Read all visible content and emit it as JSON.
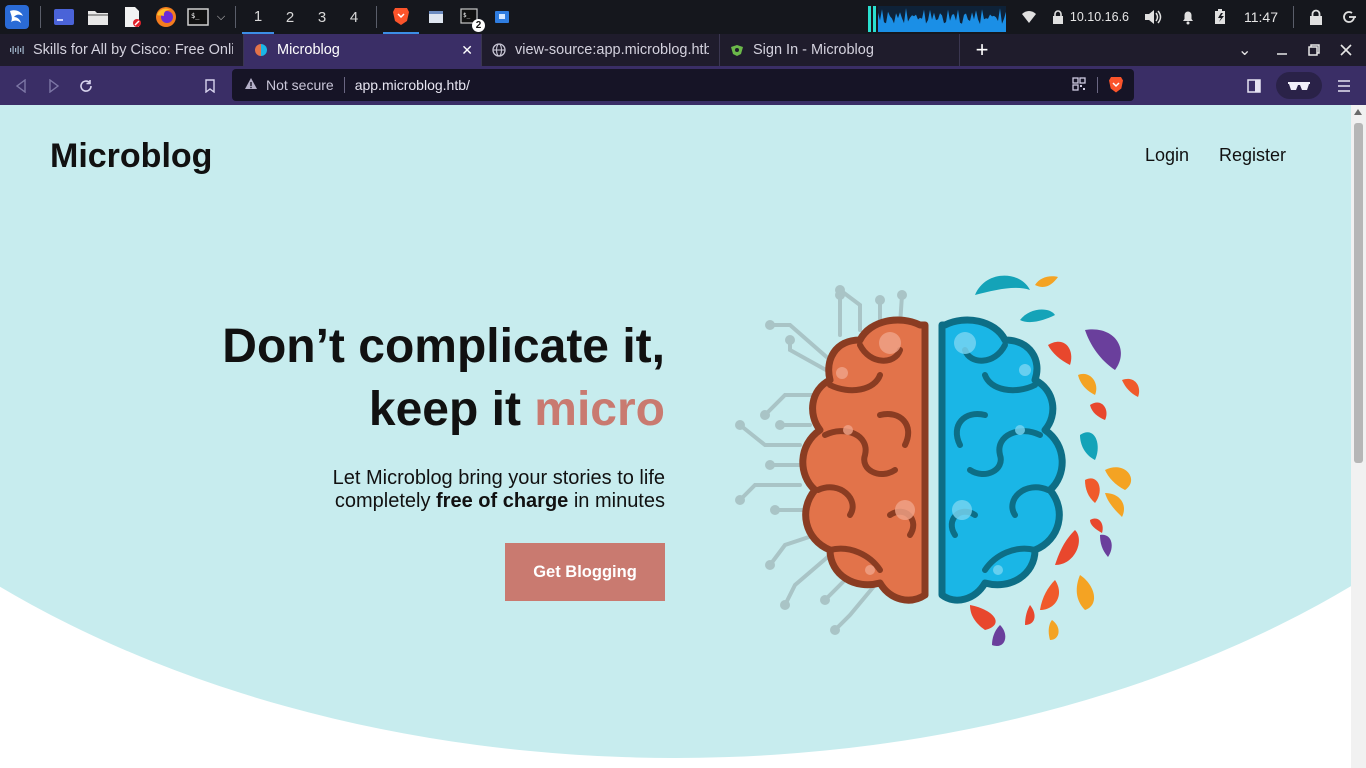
{
  "taskbar": {
    "workspaces": [
      "1",
      "2",
      "3",
      "4"
    ],
    "terminal_badge": "2",
    "ip_address": "10.10.16.6",
    "clock": "11:47"
  },
  "tabs": [
    {
      "title": "Skills for All by Cisco: Free Online",
      "active": false
    },
    {
      "title": "Microblog",
      "active": true
    },
    {
      "title": "view-source:app.microblog.htb",
      "active": false
    },
    {
      "title": "Sign In - Microblog",
      "active": false
    }
  ],
  "addressbar": {
    "security_label": "Not secure",
    "url": "app.microblog.htb/"
  },
  "page": {
    "brand": "Microblog",
    "nav": {
      "login": "Login",
      "register": "Register"
    },
    "headline_line1": "Don’t complicate it,",
    "headline_line2_prefix": "keep it ",
    "headline_line2_accent": "micro",
    "sub_line1": "Let Microblog bring your stories to life",
    "sub_line2_prefix": "completely ",
    "sub_line2_bold": "free of charge",
    "sub_line2_suffix": " in minutes",
    "cta_label": "Get Blogging"
  },
  "colors": {
    "hero_bg": "#c7ecee",
    "accent": "#c97a70",
    "brain_left": "#e2734a",
    "brain_right": "#1ab6e6",
    "browser_chrome": "#3a2e66"
  }
}
